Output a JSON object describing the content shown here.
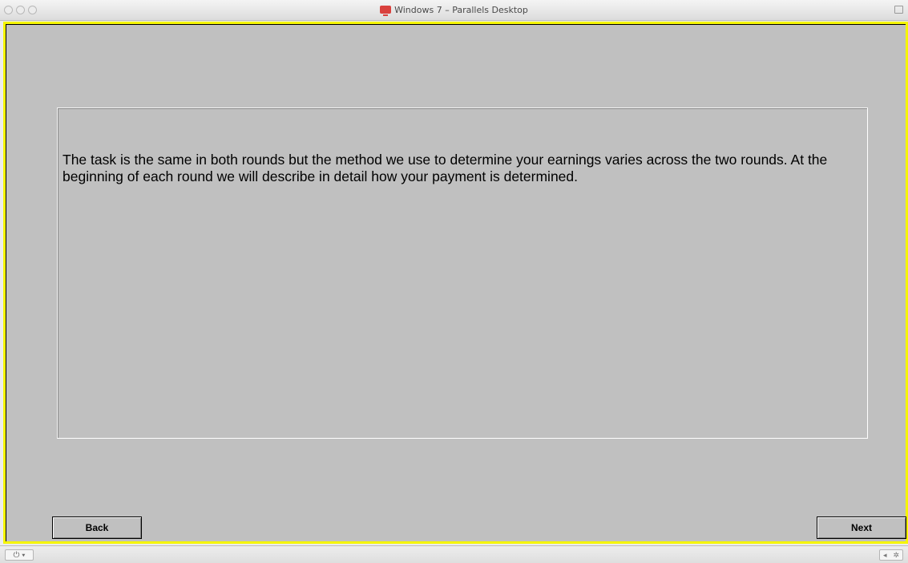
{
  "window": {
    "title": "Windows 7 – Parallels Desktop"
  },
  "colors": {
    "frame_border": "#f5f500",
    "screen_background": "#c0c0c0"
  },
  "content": {
    "instruction_text": "The task is the same in both rounds but the method we use to determine your earnings varies across the two rounds. At the beginning of each round we will describe in detail how your payment is determined."
  },
  "navigation": {
    "back_label": "Back",
    "next_label": "Next"
  },
  "statusbar": {
    "power_icon": "power-icon",
    "power_glyph": "⏻ ▾",
    "right_glyph_left": "◂",
    "right_glyph_right": "✲"
  }
}
